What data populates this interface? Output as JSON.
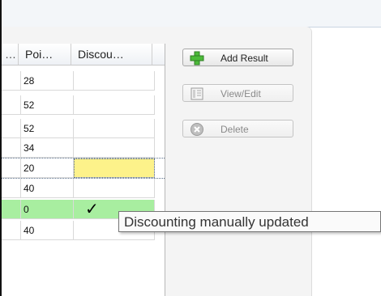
{
  "grid": {
    "columns": [
      "…",
      "Poi…",
      "Discou…"
    ],
    "rows": [
      {
        "points": "28",
        "discount": ""
      },
      {
        "points": "52",
        "discount": ""
      },
      {
        "points": "52",
        "discount": ""
      },
      {
        "points": "34",
        "discount": ""
      },
      {
        "points": "20",
        "discount": ""
      },
      {
        "points": "40",
        "discount": ""
      },
      {
        "points": "0",
        "discount": "✓"
      },
      {
        "points": "40",
        "discount": ""
      }
    ]
  },
  "buttons": {
    "add_result": "Add Result",
    "view_edit": "View/Edit",
    "delete": "Delete"
  },
  "tooltip": {
    "text": "Discounting manually updated"
  },
  "colors": {
    "highlight_row": "#a8eea0",
    "selected_cell": "#fdf28a"
  },
  "icons": {
    "add": "plus-icon",
    "view_edit": "document-icon",
    "delete": "delete-circle-icon"
  }
}
